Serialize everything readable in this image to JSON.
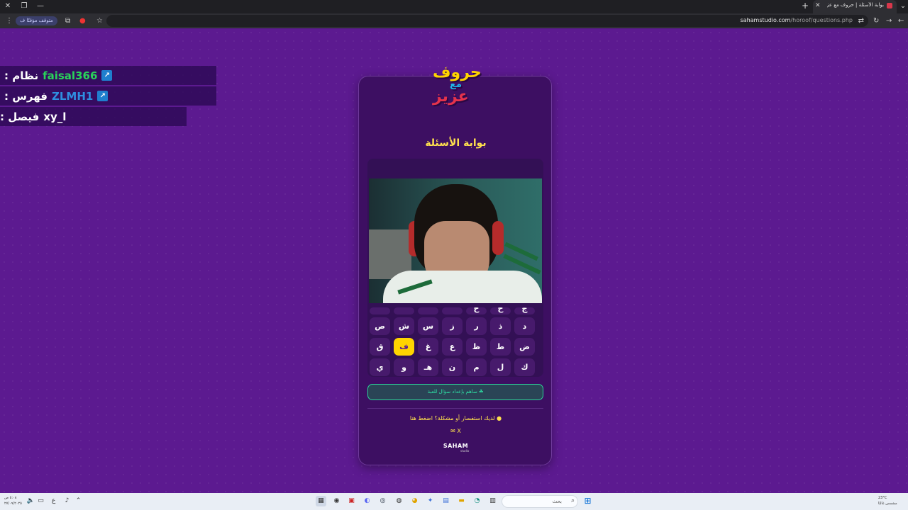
{
  "browser": {
    "tab_title": "بوابة الأسئلة | حروف مع عزيز",
    "url_host": "sahamstudio.com",
    "url_path": "/horoof/questions.php",
    "paused_label": "متوقف مؤقتًا",
    "paused_letter": "ف"
  },
  "chat": [
    {
      "name": "نظام :",
      "user": "faisal366",
      "user_color": "#29d45a",
      "badge": true
    },
    {
      "name": "فهرس :",
      "user": "ZLMH1",
      "user_color": "#2e8ee0",
      "badge": true
    },
    {
      "name": "فيصل :",
      "user": "xy_l",
      "user_color": "#ffffff",
      "badge": false
    }
  ],
  "card": {
    "logo_line1": "حروف",
    "logo_line2": "مع",
    "logo_line3": "عزيز",
    "title": "بوابة الأسئلة",
    "contribute_label": "ساهم بإعداد سؤال للعبة",
    "help_text": "لديك استفسار أو مشكلة؟ اضغط هنا",
    "socials": "✉ X",
    "brand": "SAHAM",
    "brand_sub": "studio"
  },
  "keyboard": {
    "partial_row": [
      "ج",
      "ح",
      "خ",
      "",
      "",
      "",
      ""
    ],
    "rows": [
      [
        "د",
        "ذ",
        "ر",
        "ز",
        "س",
        "ش",
        "ص"
      ],
      [
        "ض",
        "ط",
        "ظ",
        "ع",
        "غ",
        "ف",
        "ق"
      ],
      [
        "ك",
        "ل",
        "م",
        "ن",
        "هـ",
        "و",
        "ي"
      ]
    ],
    "active": "ف"
  },
  "taskbar": {
    "search_placeholder": "بحث",
    "clock_time": "٥:٠٨ ص",
    "clock_date": "٢٧/٠٩/٢٠٢٥",
    "lang": "ع",
    "weather_temp": "23°C",
    "weather_desc": "مشمس غالبًا"
  },
  "colors": {
    "background": "#5c1a90",
    "card": "#3d0f62",
    "accent_yellow": "#ffd400",
    "accent_green": "#2fe3a6"
  }
}
